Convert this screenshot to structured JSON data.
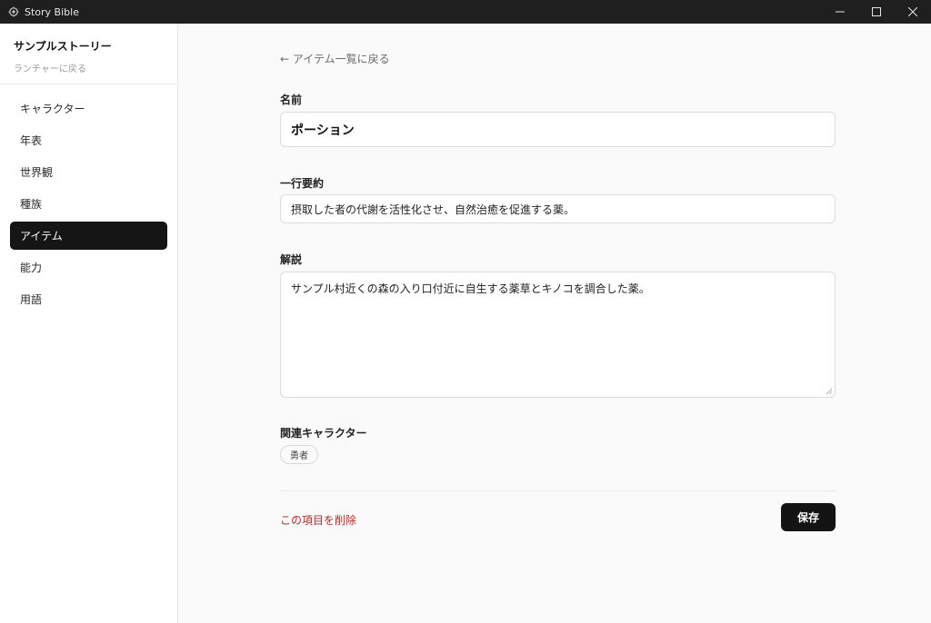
{
  "window": {
    "app_title": "Story Bible",
    "app_icon": "gear-like-app-icon",
    "controls": [
      "minimize-icon",
      "maximize-icon",
      "close-icon"
    ]
  },
  "sidebar": {
    "story_title": "サンプルストーリー",
    "back_to_launcher": "ランチャーに戻る",
    "items": [
      {
        "label": "キャラクター",
        "active": false
      },
      {
        "label": "年表",
        "active": false
      },
      {
        "label": "世界観",
        "active": false
      },
      {
        "label": "種族",
        "active": false
      },
      {
        "label": "アイテム",
        "active": true
      },
      {
        "label": "能力",
        "active": false
      },
      {
        "label": "用語",
        "active": false
      }
    ]
  },
  "main": {
    "back_link": "← アイテム一覧に戻る",
    "name": {
      "label": "名前",
      "value": "ポーション"
    },
    "summary": {
      "label": "一行要約",
      "value": "摂取した者の代謝を活性化させ、自然治癒を促進する薬。"
    },
    "description": {
      "label": "解説",
      "value": "サンプル村近くの森の入り口付近に自生する薬草とキノコを調合した薬。"
    },
    "related_characters": {
      "label": "関連キャラクター",
      "chips": [
        "勇者"
      ]
    },
    "delete_label": "この項目を削除",
    "save_label": "保存"
  },
  "colors": {
    "accent_dark": "#151515",
    "danger": "#b32a2a",
    "titlebar": "#1f1f1f"
  }
}
